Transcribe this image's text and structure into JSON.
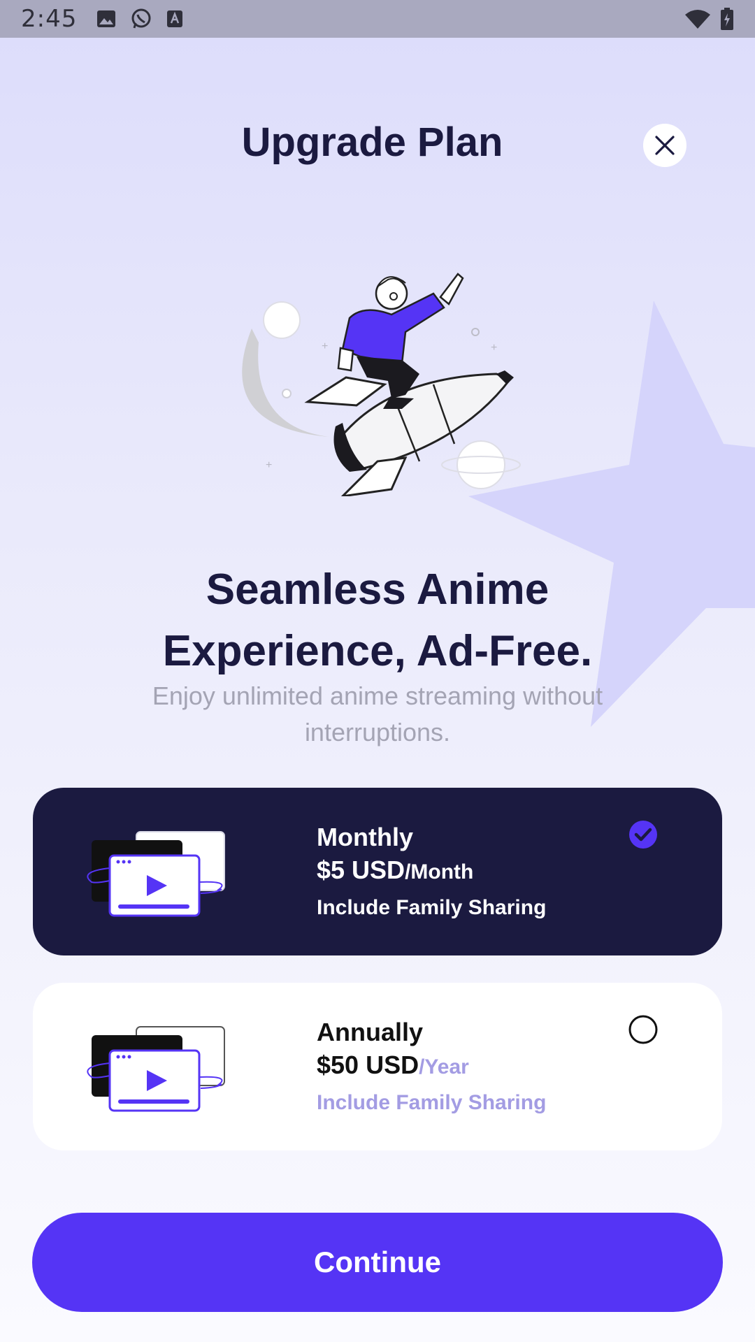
{
  "status_bar": {
    "time": "2:45",
    "left_icons": [
      "image-icon",
      "whatsapp-icon",
      "font-icon"
    ],
    "right_icons": [
      "wifi-icon",
      "battery-icon"
    ]
  },
  "header": {
    "title": "Upgrade Plan",
    "close_icon": "close-icon"
  },
  "hero": {
    "illustration": "rocket-rider-illustration",
    "headline_line1": "Seamless Anime",
    "headline_line2": "Experience, Ad-Free.",
    "subheadline_line1": "Enjoy unlimited anime streaming without",
    "subheadline_line2": "interruptions."
  },
  "plans": [
    {
      "name": "Monthly",
      "price": "$5 USD",
      "period": "/Month",
      "feature": "Include Family Sharing",
      "selected": true
    },
    {
      "name": "Annually",
      "price": "$50 USD",
      "period": "/Year",
      "feature": "Include Family Sharing",
      "selected": false
    }
  ],
  "cta": {
    "label": "Continue"
  },
  "colors": {
    "accent": "#5534f5",
    "dark_navy": "#1b1a40",
    "muted_purple": "#a39ce3",
    "background": "#e9e9fb",
    "star": "#d5d4fb"
  }
}
